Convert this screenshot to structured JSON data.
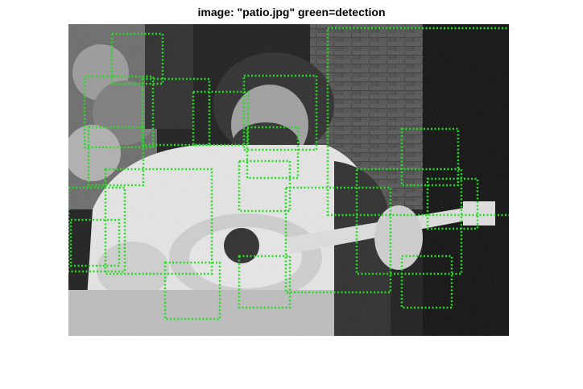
{
  "figure": {
    "title": "image: \"patio.jpg\" green=detection"
  },
  "colors": {
    "detection": "#22dd22",
    "background": "#ffffff"
  },
  "detections_count": 24
}
